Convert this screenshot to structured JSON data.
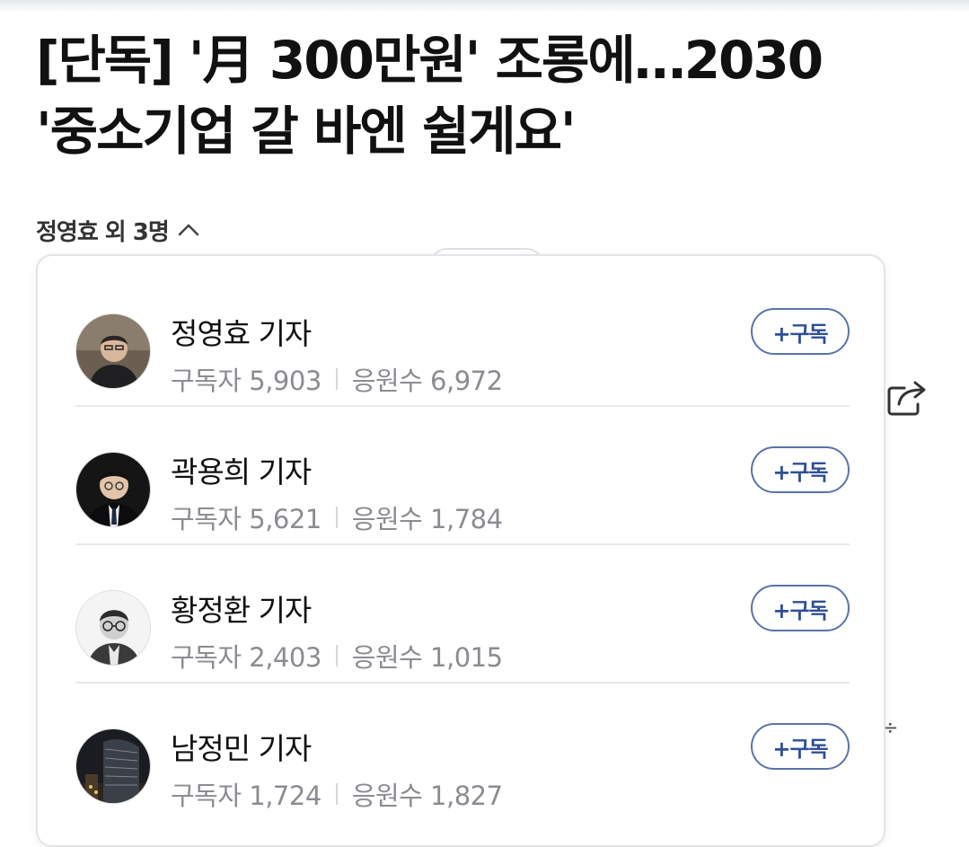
{
  "article": {
    "headline_line1": "[단독] '月 300만원' 조롱에…2030",
    "headline_line2": "'중소기업 갈 바엔 쉴게요'",
    "byline": "정영효 외 3명"
  },
  "reporters": [
    {
      "name": "정영효 기자",
      "subscribers": "구독자 5,903",
      "cheers": "응원수 6,972",
      "button": "+구독"
    },
    {
      "name": "곽용희 기자",
      "subscribers": "구독자 5,621",
      "cheers": "응원수 1,784",
      "button": "+구독"
    },
    {
      "name": "황정환 기자",
      "subscribers": "구독자 2,403",
      "cheers": "응원수 1,015",
      "button": "+구독"
    },
    {
      "name": "남정민 기자",
      "subscribers": "구독자 1,724",
      "cheers": "응원수 1,827",
      "button": "+구독"
    }
  ],
  "icons": {
    "caret": "chevron-up-icon",
    "share": "share-icon"
  },
  "colors": {
    "subscribe_accent": "#2f4f96",
    "stat_text": "#8a8c91"
  }
}
